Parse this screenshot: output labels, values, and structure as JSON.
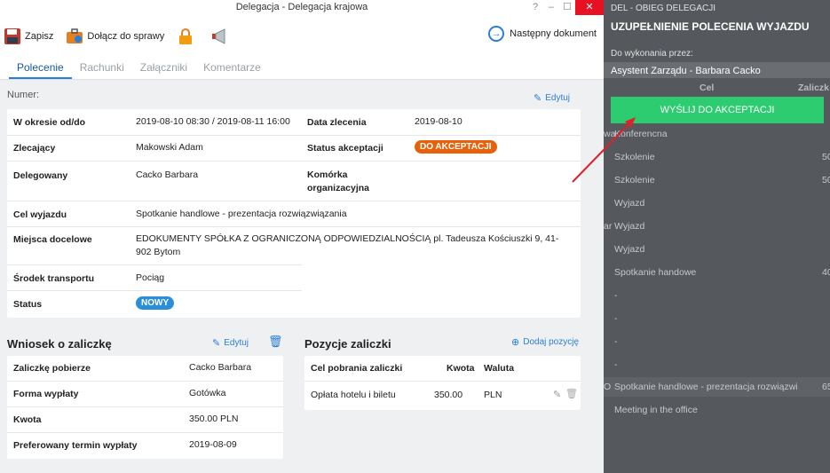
{
  "window": {
    "title": "Delegacja - Delegacja krajowa",
    "help": "?",
    "minimize": "–",
    "maximize": "☐",
    "close": "✕"
  },
  "toolbar": {
    "save_label": "Zapisz",
    "attach_label": "Dołącz do sprawy",
    "next_label": "Następny dokument"
  },
  "tabs": [
    "Polecenie",
    "Rachunki",
    "Załączniki",
    "Komentarze"
  ],
  "numer_label": "Numer:",
  "edit_label": "Edytuj",
  "main": {
    "okres_label": "W okresie od/do",
    "okres_val": "2019-08-10 08:30 / 2019-08-11 16:00",
    "data_label": "Data zlecenia",
    "data_val": "2019-08-10",
    "zlecajacy_label": "Zlecający",
    "zlecajacy_val": "Makowski Adam",
    "status_akc_label": "Status akceptacji",
    "status_akc_val": "DO AKCEPTACJI",
    "delegowany_label": "Delegowany",
    "delegowany_val": "Cacko Barbara",
    "komorka_label": "Komórka organizacyjna",
    "cel_label": "Cel wyjazdu",
    "cel_val": "Spotkanie handlowe - prezentacja rozwiązwiązania",
    "miejsca_label": "Miejsca docelowe",
    "miejsca_val": "EDOKUMENTY SPÓŁKA Z OGRANICZONĄ ODPOWIEDZIALNOŚCIĄ pl. Tadeusza Kościuszki 9, 41-902 Bytom",
    "srodek_label": "Środek transportu",
    "srodek_val": "Pociąg",
    "status_label": "Status",
    "status_val": "NOWY"
  },
  "wniosek": {
    "title": "Wniosek o zaliczkę",
    "edit_label": "Edytuj",
    "rows": [
      {
        "label": "Zaliczkę pobierze",
        "value": "Cacko Barbara"
      },
      {
        "label": "Forma wypłaty",
        "value": "Gotówka"
      },
      {
        "label": "Kwota",
        "value": "350.00 PLN"
      },
      {
        "label": "Preferowany termin wypłaty",
        "value": "2019-08-09"
      }
    ]
  },
  "pozycje": {
    "title": "Pozycje zaliczki",
    "add_label": "Dodaj pozycję",
    "headers": [
      "Cel pobrania zaliczki",
      "Kwota",
      "Waluta"
    ],
    "row": {
      "cel": "Opłata hotelu i biletu",
      "kwota": "350.00",
      "waluta": "PLN"
    }
  },
  "panel": {
    "title": "DEL - OBIEG DELEGACJI",
    "heading": "UZUPEŁNIENIE POLECENIA WYJAZDU",
    "sub": "Do wykonania przez:",
    "user": "Asystent Zarządu - Barbara Cacko",
    "send": "WYŚLIJ DO AKCEPTACJI",
    "col_cel": "Cel",
    "col_zal": "Zaliczk",
    "bg_rows": [
      {
        "left": "wa",
        "text": "Konferencna",
        "amt": ""
      },
      {
        "left": "",
        "text": "Szkolenie",
        "amt": "50"
      },
      {
        "left": "",
        "text": "Szkolenie",
        "amt": "50"
      },
      {
        "left": "",
        "text": "Wyjazd",
        "amt": ""
      },
      {
        "left": "ar",
        "text": "Wyjazd",
        "amt": ""
      },
      {
        "left": "",
        "text": "Wyjazd",
        "amt": ""
      },
      {
        "left": "",
        "text": "Spotkanie handowe",
        "amt": "40"
      },
      {
        "left": "",
        "text": "-",
        "amt": ""
      },
      {
        "left": "",
        "text": "-",
        "amt": ""
      },
      {
        "left": "",
        "text": "-",
        "amt": ""
      },
      {
        "left": "",
        "text": "-",
        "amt": ""
      },
      {
        "left": "O",
        "text": "Spotkanie handlowe - prezentacja rozwiązwi",
        "amt": "65"
      },
      {
        "left": "",
        "text": "Meeting in the office",
        "amt": ""
      }
    ]
  },
  "colors": {
    "accent": "#2a7ed8",
    "send": "#2ecc71",
    "orange": "#e8600a",
    "arrow": "#e0202a"
  }
}
